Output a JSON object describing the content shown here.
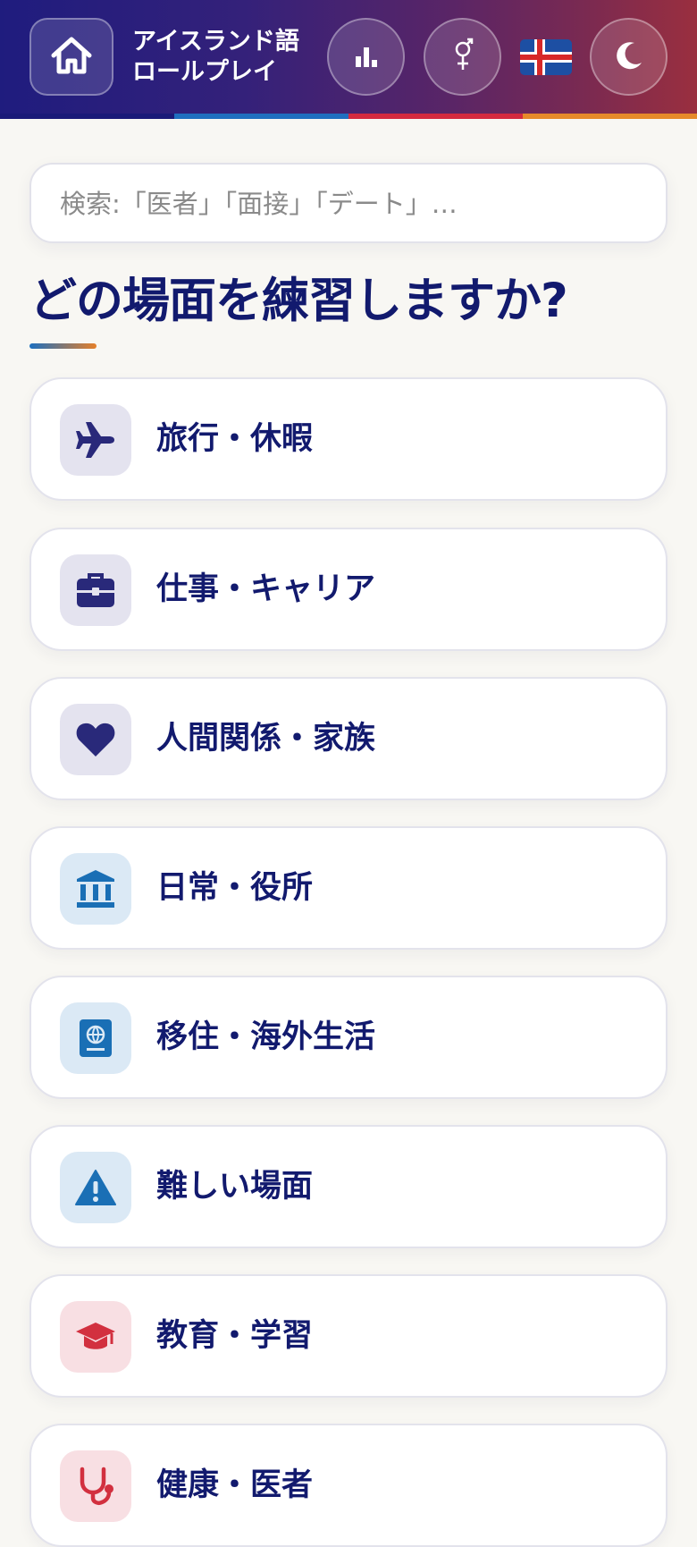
{
  "header": {
    "title": "アイスランド語\nロールプレイ",
    "home_icon": "home-icon",
    "stats_icon": "bar-chart-icon",
    "gender_icon": "gender-icon",
    "flag_icon": "iceland-flag-icon",
    "theme_icon": "moon-icon"
  },
  "colors": {
    "stripe": [
      "#1a1a78",
      "#1f6fbf",
      "#d42a3f",
      "#e68a2a"
    ],
    "heading": "#121a6e"
  },
  "search": {
    "placeholder": "検索:「医者」「面接」「デート」…",
    "value": ""
  },
  "heading": "どの場面を練習しますか?",
  "categories": [
    {
      "label": "旅行・休暇",
      "icon": "airplane-icon"
    },
    {
      "label": "仕事・キャリア",
      "icon": "briefcase-icon"
    },
    {
      "label": "人間関係・家族",
      "icon": "heart-icon"
    },
    {
      "label": "日常・役所",
      "icon": "building-icon"
    },
    {
      "label": "移住・海外生活",
      "icon": "passport-icon"
    },
    {
      "label": "難しい場面",
      "icon": "warning-icon"
    },
    {
      "label": "教育・学習",
      "icon": "graduation-cap-icon"
    },
    {
      "label": "健康・医者",
      "icon": "stethoscope-icon"
    }
  ]
}
